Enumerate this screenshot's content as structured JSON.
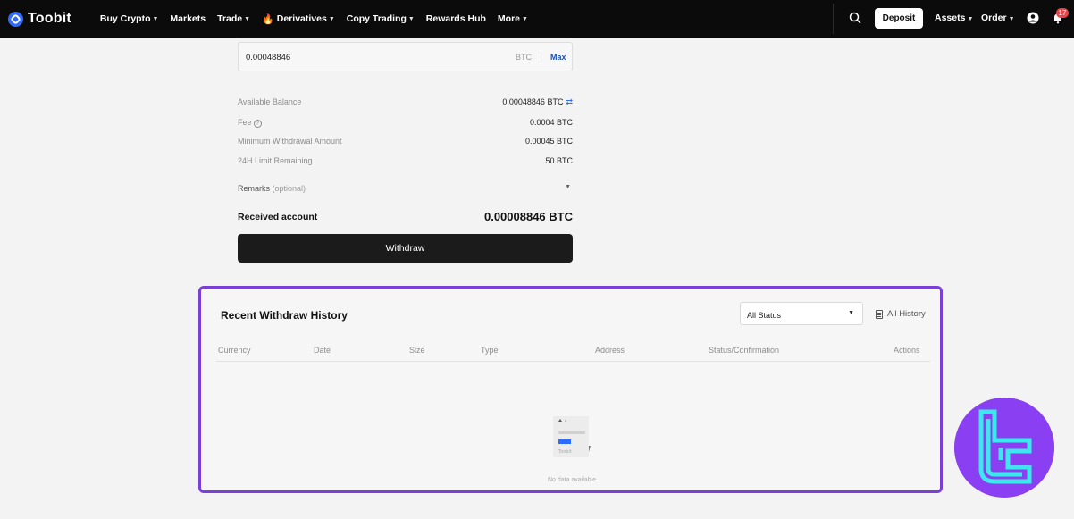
{
  "nav": {
    "brand": "Toobit",
    "items": [
      {
        "label": "Buy Crypto",
        "caret": true
      },
      {
        "label": "Markets",
        "caret": false
      },
      {
        "label": "Trade",
        "caret": true
      },
      {
        "label": "Derivatives",
        "caret": true,
        "fire": true
      },
      {
        "label": "Copy Trading",
        "caret": true
      },
      {
        "label": "Rewards Hub",
        "caret": false
      },
      {
        "label": "More",
        "caret": true
      }
    ],
    "deposit_label": "Deposit",
    "assets_label": "Assets",
    "order_label": "Order",
    "notification_count": "17",
    "icons": [
      "search-icon",
      "user-icon",
      "bell-icon"
    ]
  },
  "withdraw": {
    "amount_value": "0.00048846",
    "amount_unit": "BTC",
    "max_label": "Max",
    "rows": [
      {
        "label": "Available Balance",
        "value": "0.00048846 BTC"
      },
      {
        "label": "Fee",
        "value": "0.0004 BTC"
      },
      {
        "label": "Minimum Withdrawal Amount",
        "value": "0.00045 BTC"
      },
      {
        "label": "24H Limit Remaining",
        "value": "50 BTC"
      }
    ],
    "remarks_label": "Remarks",
    "remarks_optional": "(optional)",
    "received_label": "Received account",
    "received_value": "0.00008846 BTC",
    "withdraw_button": "Withdraw"
  },
  "history": {
    "title": "Recent Withdraw History",
    "status_select": "All Status",
    "all_history_label": "All History",
    "columns": [
      "Currency",
      "Date",
      "Size",
      "Type",
      "Address",
      "Status/Confirmation",
      "Actions"
    ],
    "empty_text": "No data available",
    "empty_illustration_text": "Toobit"
  },
  "colors": {
    "accent_purple": "#7b3fd6",
    "brand_blue": "#2e6bff",
    "nav_bg": "#0b0b0b"
  }
}
